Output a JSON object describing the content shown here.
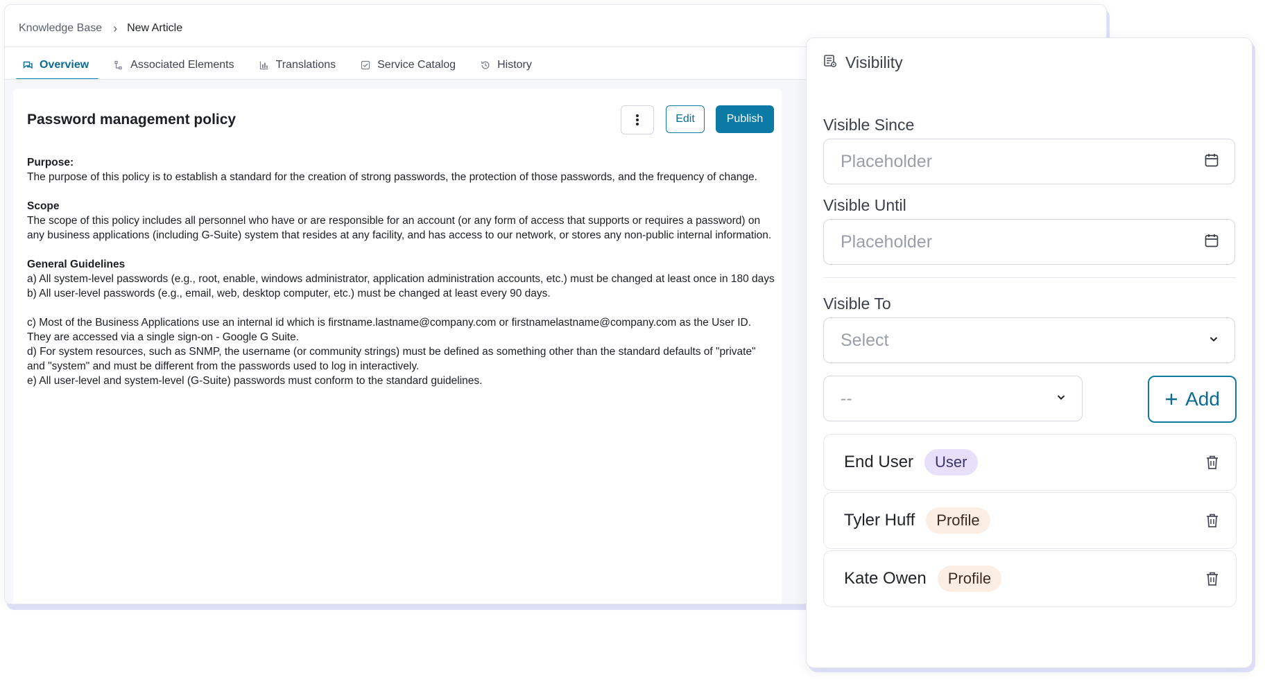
{
  "breadcrumb": {
    "parent": "Knowledge Base",
    "separator": "›",
    "current": "New Article"
  },
  "tabs": [
    {
      "label": "Overview",
      "icon": "chat-icon",
      "active": true
    },
    {
      "label": "Associated Elements",
      "icon": "hierarchy-icon"
    },
    {
      "label": "Translations",
      "icon": "bar-chart-icon"
    },
    {
      "label": "Service Catalog",
      "icon": "checkbox-icon"
    },
    {
      "label": "History",
      "icon": "history-icon"
    }
  ],
  "article": {
    "title": "Password management policy",
    "buttons": {
      "more_icon": "kebab-icon",
      "edit": "Edit",
      "publish": "Publish"
    },
    "purpose": {
      "heading": "Purpose:",
      "body": "The purpose of this policy is to establish a standard for the creation of strong passwords, the protection of those passwords, and the frequency of change."
    },
    "scope": {
      "heading": "Scope",
      "body": "The scope of this policy includes all personnel who have or are responsible for an account (or any form of access that supports or requires a password) on any business applications (including G-Suite) system that resides at any facility, and has access to our network, or stores any non-public internal information."
    },
    "guidelines": {
      "heading": "General Guidelines",
      "a": "a) All system-level passwords (e.g., root, enable, windows administrator, application administration accounts, etc.) must be changed at least once in 180 days",
      "b": "b) All user-level passwords (e.g., email, web, desktop computer, etc.) must be changed at least every 90 days.",
      "c": "c) Most of the Business Applications use an internal id which is firstname.lastname@company.com or firstnamelastname@company.com as the User ID. They are accessed via a single sign-on - Google G Suite.",
      "d": "d) For system resources, such as SNMP, the username (or community strings) must be defined as something other than the standard defaults of \"private\" and \"system\" and must be different from the passwords used to log in interactively.",
      "e": "e) All user-level and system-level (G-Suite) passwords must conform to the standard guidelines."
    }
  },
  "visibility": {
    "title": "Visibility",
    "visible_since": {
      "label": "Visible Since",
      "placeholder": "Placeholder"
    },
    "visible_until": {
      "label": "Visible Until",
      "placeholder": "Placeholder"
    },
    "visible_to": {
      "label": "Visible To",
      "placeholder": "Select"
    },
    "secondary_select": {
      "value": "--"
    },
    "add_button": "Add",
    "entries": [
      {
        "name": "End User",
        "badge": "User",
        "badge_type": "user"
      },
      {
        "name": "Tyler Huff",
        "badge": "Profile",
        "badge_type": "profile"
      },
      {
        "name": "Kate Owen",
        "badge": "Profile",
        "badge_type": "profile"
      }
    ]
  },
  "colors": {
    "accent": "#0b7aa4",
    "user_badge_bg": "#e6e0fb",
    "profile_badge_bg": "#fdeee4",
    "panel_shadow": "#c4c8f5"
  }
}
